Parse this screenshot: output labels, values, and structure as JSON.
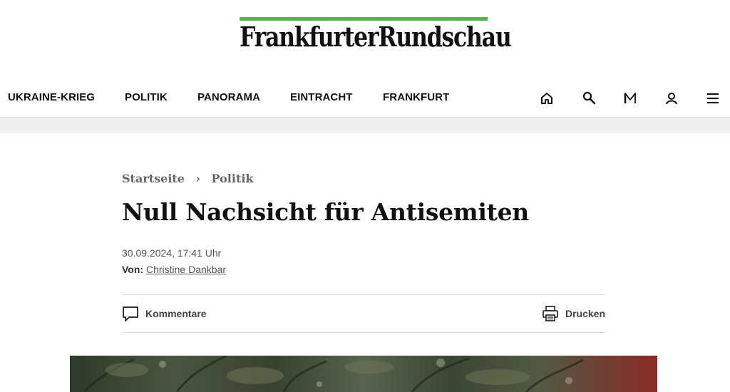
{
  "site": {
    "logo_text": "FrankfurterRundschau",
    "accent_color": "#4fb74a"
  },
  "nav": {
    "items": [
      {
        "label": "UKRAINE-KRIEG"
      },
      {
        "label": "POLITIK"
      },
      {
        "label": "PANORAMA"
      },
      {
        "label": "EINTRACHT"
      },
      {
        "label": "FRANKFURT"
      }
    ],
    "icons": [
      "home-icon",
      "search-icon",
      "m-icon",
      "user-icon",
      "menu-icon"
    ]
  },
  "breadcrumb": {
    "home": "Startseite",
    "separator": "›",
    "section": "Politik"
  },
  "article": {
    "title": "Null Nachsicht für Antisemiten",
    "date": "30.09.2024, 17:41 Uhr",
    "author_prefix": "Von:",
    "author": "Christine Dankbar"
  },
  "actions": {
    "comments_label": "Kommentare",
    "print_label": "Drucken"
  }
}
